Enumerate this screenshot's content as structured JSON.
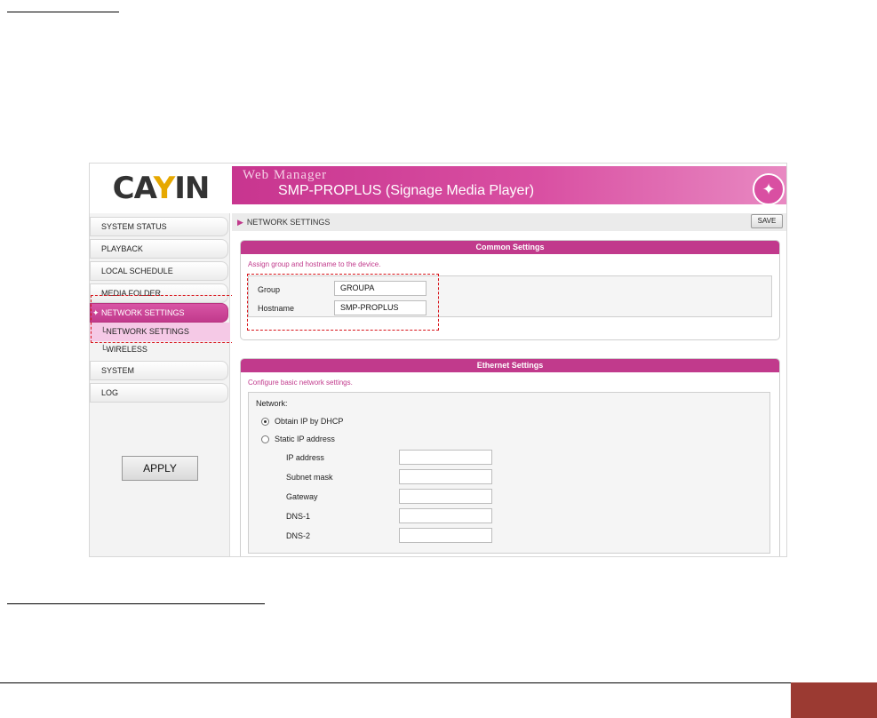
{
  "app": {
    "logo_text_left": "CA",
    "logo_text_y": "Y",
    "logo_text_right": "IN",
    "banner_label": "Web Manager",
    "banner_title": "SMP-PROPLUS (Signage Media Player)"
  },
  "sidebar": {
    "items": [
      {
        "label": "SYSTEM STATUS"
      },
      {
        "label": "PLAYBACK"
      },
      {
        "label": "LOCAL SCHEDULE"
      },
      {
        "label": "MEDIA FOLDER"
      },
      {
        "label": "NETWORK SETTINGS"
      },
      {
        "label": "SYSTEM"
      },
      {
        "label": "LOG"
      }
    ],
    "subitems": [
      {
        "label": "└NETWORK SETTINGS"
      },
      {
        "label": "└WIRELESS"
      }
    ],
    "apply_label": "APPLY"
  },
  "header": {
    "breadcrumb": "NETWORK SETTINGS",
    "save_label": "SAVE"
  },
  "common": {
    "title": "Common Settings",
    "description": "Assign group and hostname to the device.",
    "group_label": "Group",
    "group_value": "GROUPA",
    "hostname_label": "Hostname",
    "hostname_value": "SMP-PROPLUS"
  },
  "ethernet": {
    "title": "Ethernet Settings",
    "description": "Configure basic network settings.",
    "network_label": "Network:",
    "dhcp_label": "Obtain IP by DHCP",
    "static_label": "Static IP address",
    "selected": "dhcp",
    "fields": [
      {
        "label": "IP address",
        "value": ""
      },
      {
        "label": "Subnet mask",
        "value": ""
      },
      {
        "label": "Gateway",
        "value": ""
      },
      {
        "label": "DNS-1",
        "value": ""
      },
      {
        "label": "DNS-2",
        "value": ""
      }
    ]
  },
  "colors": {
    "accent": "#c13a8c",
    "highlight_dash": "#d8141a",
    "footer_tab": "#9b3a32"
  }
}
